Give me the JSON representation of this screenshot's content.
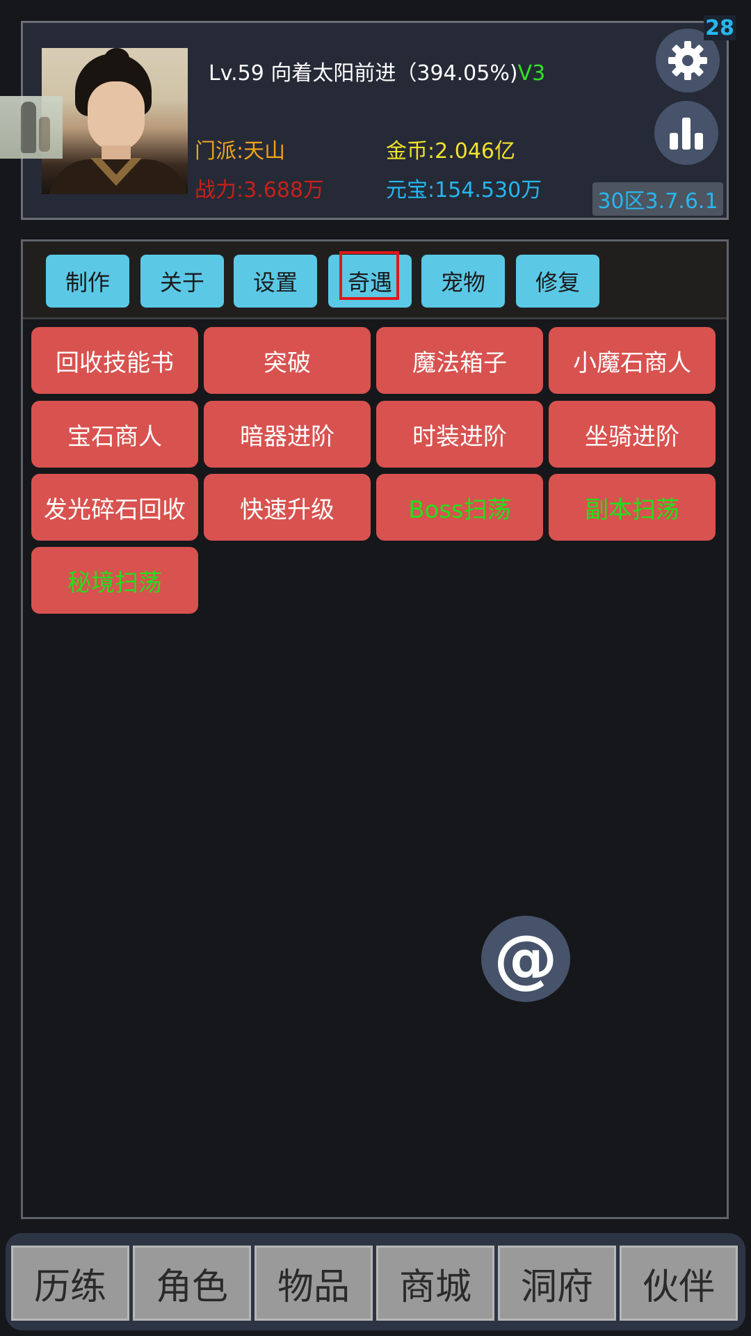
{
  "header": {
    "badge_count": "28",
    "level_line": "Lv.59 向着太阳前进（394.05%)",
    "vip": "V3",
    "sect": "门派:天山",
    "power": "战力:3.688万",
    "gold": "金币:2.046亿",
    "ingot": "元宝:154.530万",
    "server": "30区3.7.6.1",
    "icons": [
      "gear-icon",
      "bar-chart-icon"
    ]
  },
  "tabs": [
    {
      "label": "制作"
    },
    {
      "label": "关于"
    },
    {
      "label": "设置"
    },
    {
      "label": "奇遇",
      "highlighted": true
    },
    {
      "label": "宠物"
    },
    {
      "label": "修复"
    }
  ],
  "functions": [
    {
      "label": "回收技能书"
    },
    {
      "label": "突破"
    },
    {
      "label": "魔法箱子"
    },
    {
      "label": "小魔石商人"
    },
    {
      "label": "宝石商人"
    },
    {
      "label": "暗器进阶"
    },
    {
      "label": "时装进阶"
    },
    {
      "label": "坐骑进阶"
    },
    {
      "label": "发光碎石回收"
    },
    {
      "label": "快速升级"
    },
    {
      "label": "Boss扫荡"
    },
    {
      "label": "副本扫荡"
    },
    {
      "label": "秘境扫荡"
    }
  ],
  "floating": {
    "label": "@"
  },
  "bottom_nav": [
    {
      "label": "历练"
    },
    {
      "label": "角色"
    },
    {
      "label": "物品"
    },
    {
      "label": "商城"
    },
    {
      "label": "洞府"
    },
    {
      "label": "伙伴"
    }
  ],
  "colors": {
    "background": "#16171b",
    "tab": "#5bc8e6",
    "function_button": "#d8524f",
    "green_text": "#22e01c",
    "highlight": "#e01818"
  }
}
